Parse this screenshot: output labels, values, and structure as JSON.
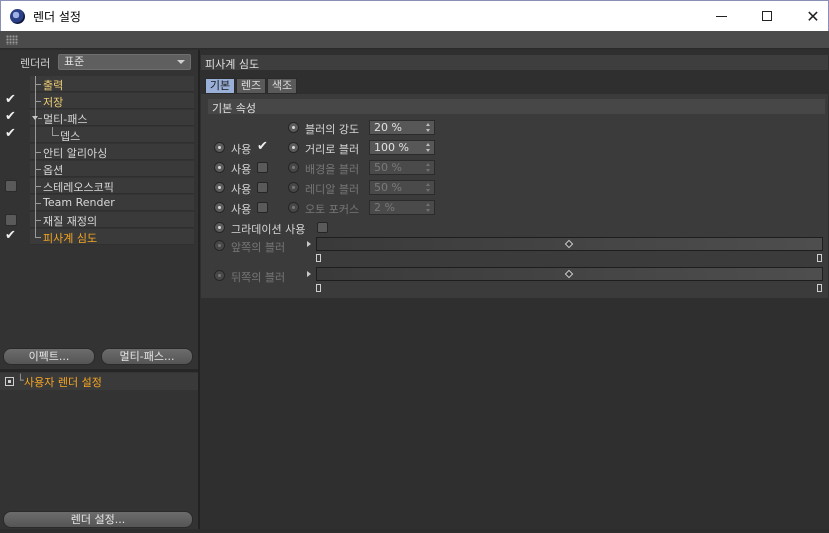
{
  "window": {
    "title": "렌더 설정",
    "controls": {
      "minimize": "minimize-icon",
      "maximize": "maximize-icon",
      "close": "close-icon"
    }
  },
  "left": {
    "renderer_label": "렌더러",
    "renderer_value": "표준",
    "tree": [
      {
        "label": "출력",
        "checked": null,
        "color": "#f0d074"
      },
      {
        "label": "저장",
        "checked": true,
        "color": "#f0d074"
      },
      {
        "label": "멀티-패스",
        "checked": true,
        "color": "#d8d8d8"
      },
      {
        "label": "뎁스",
        "checked": true,
        "color": "#d8d8d8"
      },
      {
        "label": "안티 알리아싱",
        "checked": null,
        "color": "#d8d8d8"
      },
      {
        "label": "옵션",
        "checked": null,
        "color": "#d8d8d8"
      },
      {
        "label": "스테레오스코픽",
        "checked": false,
        "color": "#d8d8d8"
      },
      {
        "label": "Team Render",
        "checked": null,
        "color": "#d8d8d8"
      },
      {
        "label": "재질 재정의",
        "checked": false,
        "color": "#d8d8d8"
      },
      {
        "label": "피사계 심도",
        "checked": true,
        "color": "#f5a623"
      }
    ],
    "effect_button": "이펙트...",
    "multipass_button": "멀티-패스...",
    "user_setting": "사용자 렌더 설정",
    "render_settings_button": "렌더 설정..."
  },
  "right": {
    "header": "피사계 심도",
    "tabs": [
      {
        "label": "기본",
        "active": true
      },
      {
        "label": "렌즈",
        "active": false
      },
      {
        "label": "색조",
        "active": false
      }
    ],
    "section_title": "기본 속성",
    "blur_strength": {
      "label": "블러의 강도",
      "value": "20 %"
    },
    "distance_blur": {
      "use_label": "사용",
      "use_checked": true,
      "label": "거리로 블러",
      "value": "100 %"
    },
    "background_blur": {
      "use_label": "사용",
      "use_checked": false,
      "label": "배경을 블러",
      "value": "50 %"
    },
    "radial_blur": {
      "use_label": "사용",
      "use_checked": false,
      "label": "레디알 블러",
      "value": "50 %"
    },
    "auto_focus": {
      "use_label": "사용",
      "use_checked": false,
      "label": "오토 포커스",
      "value": "2 %"
    },
    "gradient": {
      "label": "그라데이션 사용",
      "checked": false
    },
    "front_blur": {
      "label": "앞쪽의 블러"
    },
    "back_blur": {
      "label": "뒤쪽의 블러"
    }
  }
}
